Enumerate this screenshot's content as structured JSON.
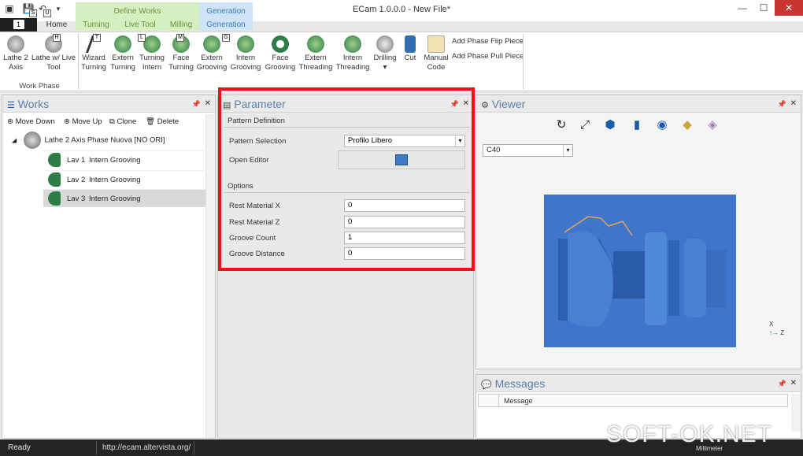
{
  "window": {
    "title": "ECam 1.0.0.0 - New File*"
  },
  "quick_access": [
    {
      "icon": "save-icon",
      "key": "S"
    },
    {
      "icon": "undo-icon",
      "key": "U"
    }
  ],
  "file_tab": {
    "key": "1"
  },
  "context_groups": {
    "define": "Define Works",
    "generation": "Generation"
  },
  "tabs": [
    "Home",
    "Turning",
    "Live Tool",
    "Milling",
    "Generation"
  ],
  "ribbon": {
    "work_phase": {
      "buttons": [
        {
          "label": "Lathe 2\nAxis",
          "icon": "lathe-2-axis-icon"
        },
        {
          "label": "Lathe w/ Live\nTool",
          "icon": "lathe-live-tool-icon",
          "key": "H"
        }
      ],
      "group_label": "Work Phase"
    },
    "operations": [
      {
        "label": "Wizard\nTurning",
        "icon": "wizard-turning-icon",
        "key": "T"
      },
      {
        "label": "Extern\nTurning",
        "icon": "extern-turning-icon"
      },
      {
        "label": "Turning\nIntern",
        "icon": "turning-intern-icon",
        "key": "L"
      },
      {
        "label": "Face\nTurning",
        "icon": "face-turning-icon",
        "key": "M"
      },
      {
        "label": "Extern\nGrooving",
        "icon": "extern-grooving-icon",
        "key": "G"
      },
      {
        "label": "Intern\nGrooving",
        "icon": "intern-grooving-icon"
      },
      {
        "label": "Face\nGrooving",
        "icon": "face-grooving-icon"
      },
      {
        "label": "Extern\nThreading",
        "icon": "extern-threading-icon"
      },
      {
        "label": "Intern\nThreading",
        "icon": "intern-threading-icon"
      },
      {
        "label": "Drilling\n▾",
        "icon": "drilling-icon"
      },
      {
        "label": "Cut",
        "icon": "cut-icon"
      },
      {
        "label": "Manual\nCode",
        "icon": "manual-code-icon"
      }
    ],
    "flip": "Add Phase Flip Piece",
    "pull": "Add Phase Pull Piece"
  },
  "works": {
    "title": "Works",
    "toolbar": {
      "move_down": "Move Down",
      "move_up": "Move Up",
      "clone": "Clone",
      "delete": "Delete"
    },
    "root": "Lathe 2 Axis Phase Nuova [NO ORI]",
    "items": [
      {
        "id": "Lav 1",
        "name": "Intern Grooving"
      },
      {
        "id": "Lav 2",
        "name": "Intern Grooving"
      },
      {
        "id": "Lav 3",
        "name": "Intern Grooving"
      }
    ]
  },
  "parameter": {
    "title": "Parameter",
    "pattern_definition": "Pattern Definition",
    "pattern_selection_label": "Pattern Selection",
    "pattern_selection_value": "Profilo Libero",
    "open_editor_label": "Open Editor",
    "options": "Options",
    "rest_x_label": "Rest Material X",
    "rest_x": "0",
    "rest_z_label": "Rest Material Z",
    "rest_z": "0",
    "groove_count_label": "Groove Count",
    "groove_count": "1",
    "groove_distance_label": "Groove Distance",
    "groove_distance": "0"
  },
  "viewer": {
    "title": "Viewer",
    "material": "C40",
    "axis_x": "X",
    "axis_z": "Z"
  },
  "messages": {
    "title": "Messages",
    "column": "Message"
  },
  "status": {
    "ready": "Ready",
    "url": "http://ecam.altervista.org/",
    "unit": "Millimeter"
  },
  "watermark": "SOFT-OK.NET",
  "colors": {
    "accent": "#3f76c9",
    "highlight": "#e8121a",
    "green": "#2e7d46"
  }
}
